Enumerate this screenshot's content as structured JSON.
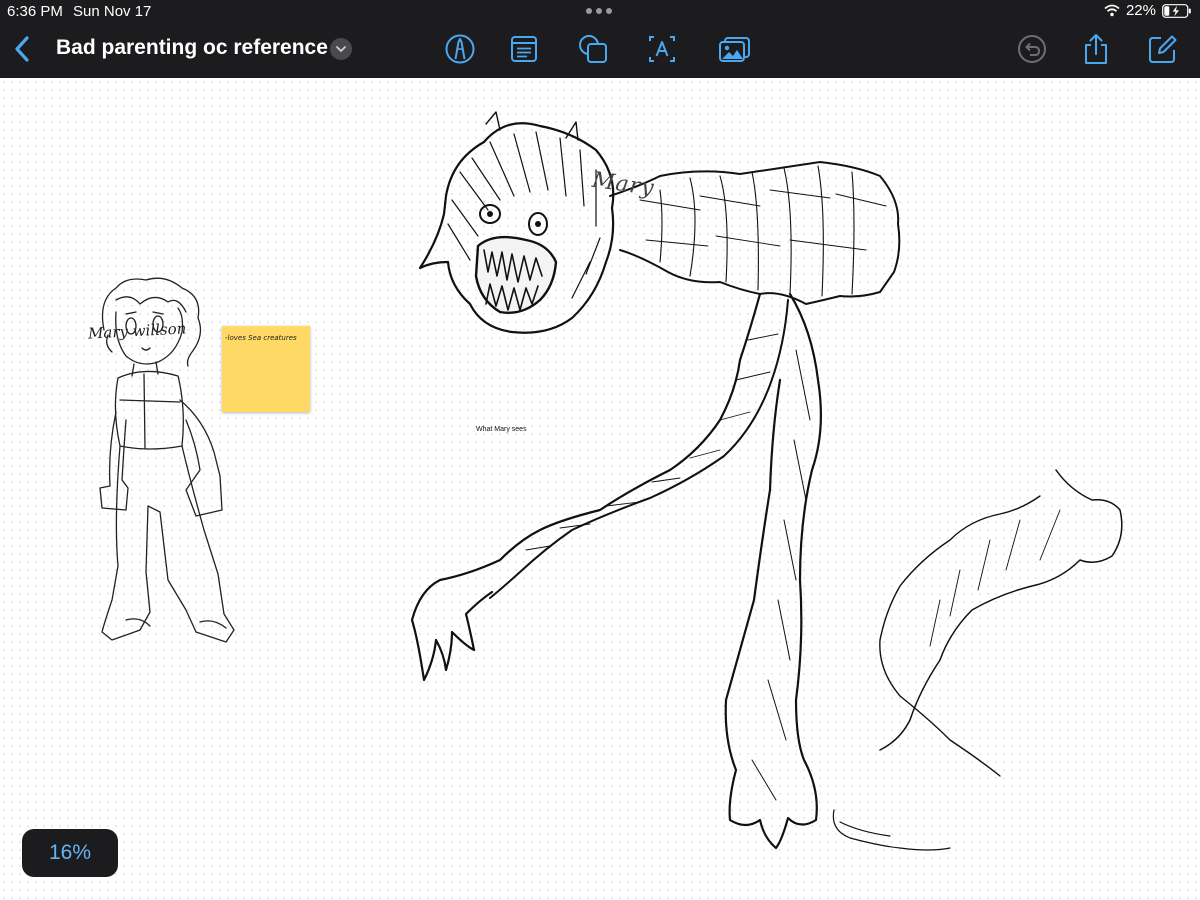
{
  "status_bar": {
    "time": "6:36 PM",
    "date": "Sun Nov 17",
    "battery": "22%",
    "icons": [
      "wifi-icon",
      "battery-charging-icon"
    ]
  },
  "toolbar": {
    "title": "Bad parenting oc reference",
    "left_icons": [
      "chevron-left-icon",
      "chevron-down-icon"
    ],
    "tool_icons": [
      "pen-icon",
      "text-box-icon",
      "shapes-icon",
      "text-label-icon",
      "image-icon"
    ],
    "right_icons": [
      "undo-icon",
      "share-icon",
      "compose-icon"
    ],
    "accent": "#4aa8f0"
  },
  "canvas": {
    "label_mary": "Mary",
    "label_mary_willson": "Mary willson",
    "sticky_note": "-loves Sea creatures",
    "sticky_color": "#ffd966",
    "caption": "What Mary sees"
  },
  "zoom": {
    "label": "16%"
  }
}
